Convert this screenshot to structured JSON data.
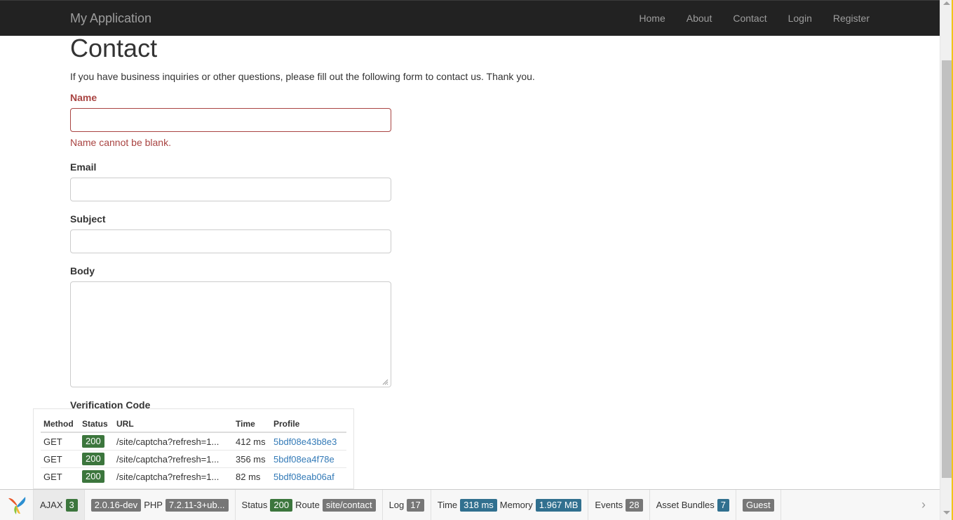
{
  "navbar": {
    "brand": "My Application",
    "items": [
      "Home",
      "About",
      "Contact",
      "Login",
      "Register"
    ]
  },
  "page": {
    "title": "Contact",
    "intro": "If you have business inquiries or other questions, please fill out the following form to contact us. Thank you."
  },
  "form": {
    "name_label": "Name",
    "name_value": "",
    "name_error": "Name cannot be blank.",
    "email_label": "Email",
    "email_value": "",
    "subject_label": "Subject",
    "subject_value": "",
    "body_label": "Body",
    "body_value": "",
    "verification_label": "Verification Code"
  },
  "ajax_panel": {
    "headers": [
      "Method",
      "Status",
      "URL",
      "Time",
      "Profile"
    ],
    "rows": [
      {
        "method": "GET",
        "status": "200",
        "url": "/site/captcha?refresh=1...",
        "time": "412 ms",
        "profile": "5bdf08e43b8e3"
      },
      {
        "method": "GET",
        "status": "200",
        "url": "/site/captcha?refresh=1...",
        "time": "356 ms",
        "profile": "5bdf08ea4f78e"
      },
      {
        "method": "GET",
        "status": "200",
        "url": "/site/captcha?refresh=1...",
        "time": "82 ms",
        "profile": "5bdf08eab06af"
      }
    ]
  },
  "toolbar": {
    "ajax_label": "AJAX",
    "ajax_count": "3",
    "yii_version": "2.0.16-dev",
    "php_label": "PHP",
    "php_version": "7.2.11-3+ub...",
    "status_label": "Status",
    "status_value": "200",
    "route_label": "Route",
    "route_value": "site/contact",
    "log_label": "Log",
    "log_count": "17",
    "time_label": "Time",
    "time_value": "318 ms",
    "memory_label": "Memory",
    "memory_value": "1.967 MB",
    "events_label": "Events",
    "events_count": "28",
    "assets_label": "Asset Bundles",
    "assets_count": "7",
    "user_value": "Guest",
    "collapse_glyph": "›"
  }
}
